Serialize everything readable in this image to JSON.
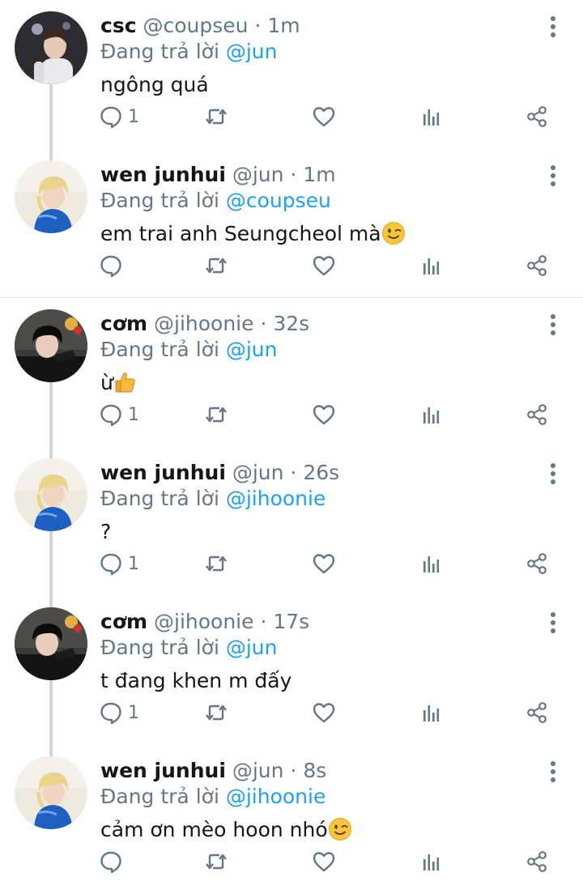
{
  "thread": [
    {
      "avatar": "avatar-csc",
      "name": "csc",
      "handle": "@coupseu",
      "time": "1m",
      "reply_prefix": "Đang trả lời ",
      "reply_to": "@jun",
      "text": "ngông quá",
      "emoji": "",
      "reply_count": "1"
    },
    {
      "avatar": "avatar-wen",
      "name": "wen junhui",
      "handle": "@jun",
      "time": "1m",
      "reply_prefix": "Đang trả lời ",
      "reply_to": "@coupseu",
      "text": "em trai anh Seungcheol mà",
      "emoji": "winking-face-emoji",
      "reply_count": ""
    },
    {
      "avatar": "avatar-com",
      "name": "cơm",
      "handle": "@jihoonie",
      "time": "32s",
      "reply_prefix": "Đang trả lời ",
      "reply_to": "@jun",
      "text": "ừ",
      "emoji": "thumbs-up-emoji",
      "reply_count": "1"
    },
    {
      "avatar": "avatar-wen",
      "name": "wen junhui",
      "handle": "@jun",
      "time": "26s",
      "reply_prefix": "Đang trả lời ",
      "reply_to": "@jihoonie",
      "text": "?",
      "emoji": "",
      "reply_count": "1"
    },
    {
      "avatar": "avatar-com",
      "name": "cơm",
      "handle": "@jihoonie",
      "time": "17s",
      "reply_prefix": "Đang trả lời ",
      "reply_to": "@jun",
      "text": "t đang khen m đấy",
      "emoji": "",
      "reply_count": "1"
    },
    {
      "avatar": "avatar-wen",
      "name": "wen junhui",
      "handle": "@jun",
      "time": "8s",
      "reply_prefix": "Đang trả lời ",
      "reply_to": "@jihoonie",
      "text": "cảm ơn mèo hoon nhó",
      "emoji": "winking-face-emoji",
      "reply_count": ""
    }
  ],
  "separator": " · ",
  "colors": {
    "accent": "#1da1f2",
    "muted": "#657786",
    "icon": "#657786",
    "thread_line": "#ccd6dd",
    "divider": "#e1e8ed"
  },
  "icons": [
    "more-vertical-icon",
    "reply-icon",
    "retweet-icon",
    "like-icon",
    "stats-icon",
    "share-icon"
  ]
}
